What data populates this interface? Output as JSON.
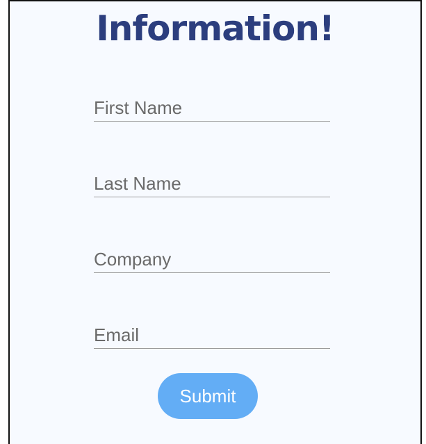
{
  "form": {
    "title": "Information!",
    "fields": [
      {
        "placeholder": "First Name",
        "value": ""
      },
      {
        "placeholder": "Last Name",
        "value": ""
      },
      {
        "placeholder": "Company",
        "value": ""
      },
      {
        "placeholder": "Email",
        "value": ""
      }
    ],
    "submit_label": "Submit"
  },
  "colors": {
    "title": "#2c3e7e",
    "background": "#f7faff",
    "submit_button": "#63adf5",
    "underline": "#9a9a9a"
  }
}
